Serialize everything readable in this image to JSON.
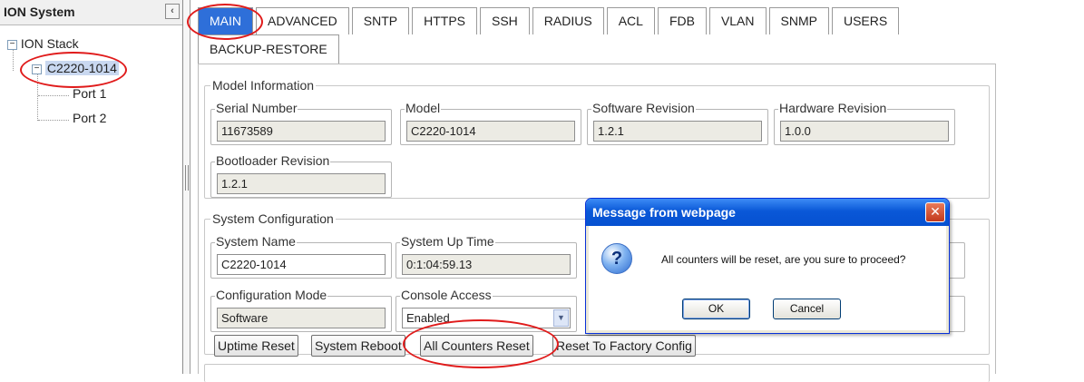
{
  "left_panel": {
    "title": "ION System",
    "collapse_glyph": "‹",
    "tree": {
      "root_label": "ION Stack",
      "root_toggle": "−",
      "device_label": "C2220-1014",
      "device_toggle": "−",
      "ports": [
        "Port 1",
        "Port 2"
      ]
    }
  },
  "tabs": {
    "row1": [
      "MAIN",
      "ADVANCED",
      "SNTP",
      "HTTPS",
      "SSH",
      "RADIUS",
      "ACL",
      "FDB",
      "VLAN",
      "SNMP",
      "USERS"
    ],
    "row2": [
      "BACKUP-RESTORE"
    ],
    "active": "MAIN"
  },
  "model_info": {
    "title": "Model Information",
    "serial_label": "Serial Number",
    "serial_value": "11673589",
    "model_label": "Model",
    "model_value": "C2220-1014",
    "sw_label": "Software Revision",
    "sw_value": "1.2.1",
    "hw_label": "Hardware Revision",
    "hw_value": "1.0.0",
    "boot_label": "Bootloader Revision",
    "boot_value": "1.2.1"
  },
  "system_config": {
    "title": "System Configuration",
    "name_label": "System Name",
    "name_value": "C2220-1014",
    "uptime_label": "System Up Time",
    "uptime_value": "0:1:04:59.13",
    "config_mode_label": "Configuration Mode",
    "config_mode_value": "Software",
    "console_label": "Console Access",
    "console_value": "Enabled",
    "console_arrow": "▼"
  },
  "buttons": {
    "uptime_reset": "Uptime Reset",
    "system_reboot": "System Reboot",
    "all_counters_reset": "All Counters Reset",
    "factory_reset": "Reset To Factory Config"
  },
  "dialog": {
    "title": "Message from webpage",
    "close_glyph": "✕",
    "icon_glyph": "?",
    "message": "All counters will be reset, are you sure to proceed?",
    "ok_label": "OK",
    "cancel_label": "Cancel"
  },
  "colors": {
    "active_tab": "#2e6fd9",
    "annotation": "#e01b1b",
    "dialog_title": "#0a58d8"
  }
}
